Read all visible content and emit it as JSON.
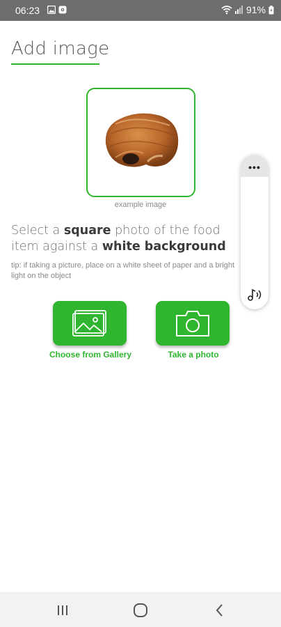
{
  "status_bar": {
    "time": "06:23",
    "battery": "91%",
    "icons": [
      "image-icon",
      "settings-badge-icon",
      "wifi-icon",
      "signal-icon",
      "battery-icon"
    ]
  },
  "header": {
    "title": "Add image"
  },
  "example": {
    "caption": "example image",
    "image": "croissant-icon"
  },
  "instruction": {
    "part1": "Select a ",
    "emph1": "square",
    "part2": " photo of the food item against a ",
    "emph2": "white background"
  },
  "tip": "tip: if taking a picture, place on a white sheet of paper and a bright light on the object",
  "actions": {
    "gallery_label": "Choose from Gallery",
    "camera_label": "Take a photo"
  },
  "side_panel": {
    "more": "•••",
    "icons": [
      "more-icon",
      "audio-accessibility-icon"
    ]
  },
  "nav": {
    "icons": [
      "recent-apps-icon",
      "home-icon",
      "back-icon"
    ]
  },
  "colors": {
    "accent": "#2fb52f",
    "status_bar": "#6d6d6d",
    "nav_bar": "#f2f2f2"
  }
}
